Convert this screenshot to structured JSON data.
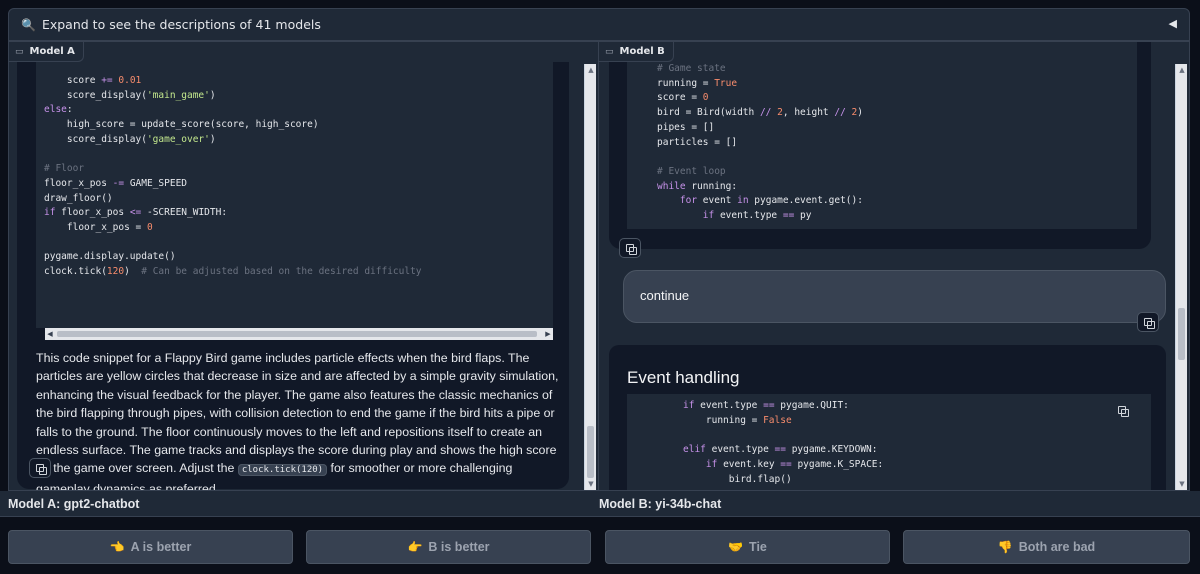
{
  "accordion": {
    "label": "Expand to see the descriptions of 41 models",
    "search_icon": "🔍",
    "caret": "◀"
  },
  "model_a": {
    "chip_label": "Model A",
    "code_lines": [
      "    score += 0.01",
      "    score_display('main_game')",
      "else:",
      "    high_score = update_score(score, high_score)",
      "    score_display('game_over')",
      "",
      "# Floor",
      "floor_x_pos -= GAME_SPEED",
      "draw_floor()",
      "if floor_x_pos <= -SCREEN_WIDTH:",
      "    floor_x_pos = 0",
      "",
      "pygame.display.update()",
      "clock.tick(120)  # Can be adjusted based on the desired difficulty"
    ],
    "description_before": "This code snippet for a Flappy Bird game includes particle effects when the bird flaps. The particles are yellow circles that decrease in size and are affected by a simple gravity simulation, enhancing the visual feedback for the player. The game also features the classic mechanics of the bird flapping through pipes, with collision detection to end the game if the bird hits a pipe or falls to the ground. The floor continuously moves to the left and repositions itself to create an endless surface. The game tracks and displays the score during play and shows the high score on the game over screen. Adjust the ",
    "description_code": "clock.tick(120)",
    "description_after": " for smoother or more challenging gameplay dynamics as preferred.",
    "name": "Model A: gpt2-chatbot"
  },
  "model_b": {
    "chip_label": "Model B",
    "code_lines_1": [
      "# Game state",
      "running = True",
      "score = 0",
      "bird = Bird(width // 2, height // 2)",
      "pipes = []",
      "particles = []",
      "",
      "# Event loop",
      "while running:",
      "    for event in pygame.event.get():",
      "        if event.type == py"
    ],
    "user_message": "continue",
    "heading": "Event handling",
    "code_lines_2": [
      "if event.type == pygame.QUIT:",
      "    running = False",
      "",
      "elif event.type == pygame.KEYDOWN:",
      "    if event.key == pygame.K_SPACE:",
      "        bird.flap()"
    ],
    "name": "Model B: yi-34b-chat"
  },
  "votes": [
    {
      "emoji": "👈",
      "label": "A is better"
    },
    {
      "emoji": "👉",
      "label": "B is better"
    },
    {
      "emoji": "🤝",
      "label": "Tie"
    },
    {
      "emoji": "👎",
      "label": "Both are bad"
    }
  ]
}
